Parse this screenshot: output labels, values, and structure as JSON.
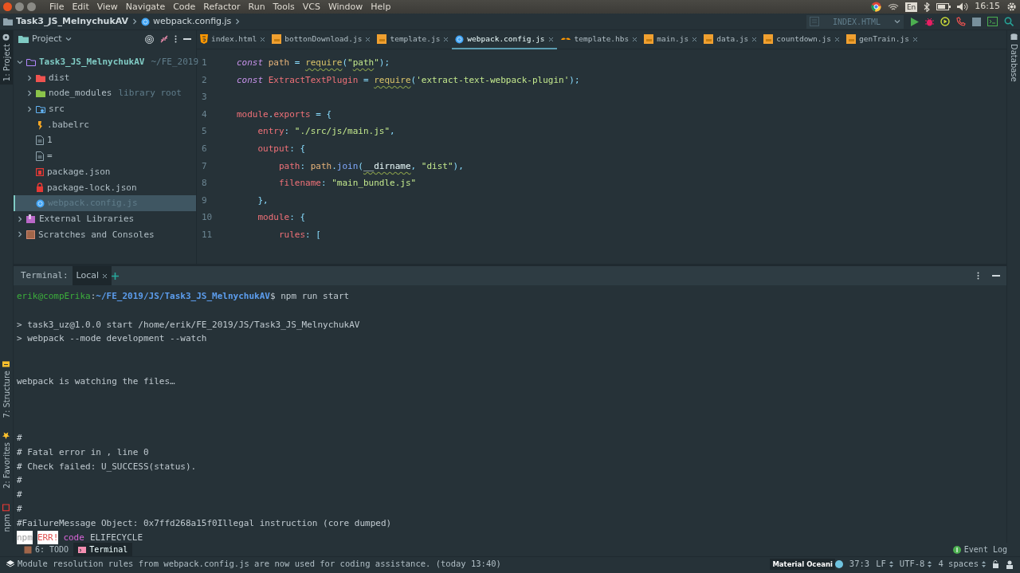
{
  "menu": [
    "File",
    "Edit",
    "View",
    "Navigate",
    "Code",
    "Refactor",
    "Run",
    "Tools",
    "VCS",
    "Window",
    "Help"
  ],
  "tray": {
    "keyboard_layout": "En",
    "time": "16:15"
  },
  "breadcrumb": [
    {
      "label": "Task3_JS_MelnychukAV",
      "kind": "folder"
    },
    {
      "label": "webpack.config.js",
      "kind": "webpack"
    }
  ],
  "run_config": {
    "label": "INDEX.HTML"
  },
  "top_tools": [
    {
      "label": "1: Project",
      "selected": true
    }
  ],
  "bottom_tools": [
    {
      "label": "7: Structure",
      "kind": "structure"
    },
    {
      "label": "2: Favorites",
      "kind": "favorites"
    },
    {
      "label": "npm",
      "kind": "npm"
    }
  ],
  "right_tools": [
    {
      "label": "Database"
    }
  ],
  "project": {
    "title": "Project",
    "tree": [
      {
        "label": "Task3_JS_MelnychukAV",
        "hint": "~/FE_2019",
        "kind": "folder-root",
        "expanded": true,
        "selected": false,
        "children": [
          {
            "label": "dist",
            "kind": "folder-dist",
            "expanded": false,
            "selected": false
          },
          {
            "label": "node_modules",
            "hint": "library root",
            "kind": "folder-lib",
            "expanded": false,
            "selected": false
          },
          {
            "label": "src",
            "kind": "folder-src",
            "expanded": false,
            "selected": false
          },
          {
            "label": ".babelrc",
            "kind": "babel",
            "selected": false
          },
          {
            "label": "1",
            "kind": "text",
            "selected": false
          },
          {
            "label": "=",
            "kind": "text",
            "selected": false
          },
          {
            "label": "package.json",
            "kind": "npm",
            "selected": false
          },
          {
            "label": "package-lock.json",
            "kind": "lock",
            "selected": false
          },
          {
            "label": "webpack.config.js",
            "kind": "webpack",
            "selected": true
          }
        ]
      },
      {
        "label": "External Libraries",
        "kind": "libraries",
        "expanded": false,
        "selected": false
      },
      {
        "label": "Scratches and Consoles",
        "kind": "scratches",
        "expanded": false,
        "selected": false
      }
    ]
  },
  "editor": {
    "tabs": [
      {
        "label": "index.html",
        "kind": "html",
        "selected": false
      },
      {
        "label": "bottonDownload.js",
        "kind": "js",
        "selected": false
      },
      {
        "label": "template.js",
        "kind": "js",
        "selected": false
      },
      {
        "label": "webpack.config.js",
        "kind": "webpack",
        "selected": true
      },
      {
        "label": "template.hbs",
        "kind": "hbs",
        "selected": false
      },
      {
        "label": "main.js",
        "kind": "js",
        "selected": false
      },
      {
        "label": "data.js",
        "kind": "js",
        "selected": false
      },
      {
        "label": "countdown.js",
        "kind": "js",
        "selected": false
      },
      {
        "label": "genTrain.js",
        "kind": "js",
        "selected": false
      }
    ],
    "lines": [
      {
        "number": "1",
        "tokens": [
          {
            "text": "const ",
            "kind": "kw"
          },
          {
            "text": "path",
            "kind": "var"
          },
          {
            "text": " = ",
            "kind": "punct"
          },
          {
            "text": "require",
            "kind": "func",
            "squiggle": true
          },
          {
            "text": "(",
            "kind": "punct"
          },
          {
            "text": "\"",
            "kind": "str"
          },
          {
            "text": "path",
            "kind": "str",
            "squiggle": true
          },
          {
            "text": "\"",
            "kind": "str"
          },
          {
            "text": ");",
            "kind": "punct"
          }
        ]
      },
      {
        "number": "2",
        "tokens": [
          {
            "text": "const ",
            "kind": "kw"
          },
          {
            "text": "ExtractTextPlugin",
            "kind": "cls"
          },
          {
            "text": " = ",
            "kind": "punct"
          },
          {
            "text": "require",
            "kind": "func",
            "squiggle": true
          },
          {
            "text": "(",
            "kind": "punct"
          },
          {
            "text": "'extract-text-webpack-plugin'",
            "kind": "str"
          },
          {
            "text": ");",
            "kind": "punct"
          }
        ]
      },
      {
        "number": "3"
      },
      {
        "number": "4",
        "tokens": [
          {
            "text": "module",
            "kind": "prop"
          },
          {
            "text": ".",
            "kind": "punct"
          },
          {
            "text": "exports",
            "kind": "prop"
          },
          {
            "text": " = {",
            "kind": "punct"
          }
        ]
      },
      {
        "number": "5",
        "tokens": [
          {
            "text": "    entry",
            "kind": "prop"
          },
          {
            "text": ": ",
            "kind": "punct"
          },
          {
            "text": "\"./src/js/main.js\"",
            "kind": "str"
          },
          {
            "text": ",",
            "kind": "punct"
          }
        ]
      },
      {
        "number": "6",
        "tokens": [
          {
            "text": "    output",
            "kind": "prop"
          },
          {
            "text": ": {",
            "kind": "punct"
          }
        ]
      },
      {
        "number": "7",
        "tokens": [
          {
            "text": "        path",
            "kind": "prop"
          },
          {
            "text": ": ",
            "kind": "punct"
          },
          {
            "text": "path",
            "kind": "var"
          },
          {
            "text": ".",
            "kind": "punct"
          },
          {
            "text": "join",
            "kind": "method"
          },
          {
            "text": "(",
            "kind": "punct"
          },
          {
            "text": "__dirname",
            "kind": "plain",
            "squiggle": true
          },
          {
            "text": ", ",
            "kind": "punct"
          },
          {
            "text": "\"dist\"",
            "kind": "str"
          },
          {
            "text": "),",
            "kind": "punct"
          }
        ]
      },
      {
        "number": "8",
        "tokens": [
          {
            "text": "        filename",
            "kind": "prop"
          },
          {
            "text": ": ",
            "kind": "punct"
          },
          {
            "text": "\"main_bundle.js\"",
            "kind": "str"
          }
        ]
      },
      {
        "number": "9",
        "tokens": [
          {
            "text": "    },",
            "kind": "punct"
          }
        ]
      },
      {
        "number": "10",
        "tokens": [
          {
            "text": "    module",
            "kind": "prop"
          },
          {
            "text": ": {",
            "kind": "punct"
          }
        ]
      },
      {
        "number": "11",
        "tokens": [
          {
            "text": "        rules",
            "kind": "prop"
          },
          {
            "text": ": [",
            "kind": "punct"
          }
        ]
      }
    ]
  },
  "terminal": {
    "title": "Terminal:",
    "tabs": [
      {
        "label": "Local",
        "selected": true
      }
    ],
    "lines": [
      {
        "kind": "text",
        "segments": [
          {
            "text": "erik@compErika",
            "kind": "user"
          },
          {
            "text": ":",
            "kind": "plain"
          },
          {
            "text": "~/FE_2019/JS/Task3_JS_MelnychukAV",
            "kind": "path"
          },
          {
            "text": "$ npm run start",
            "kind": "plain"
          }
        ]
      },
      {
        "kind": "blank"
      },
      {
        "kind": "text",
        "segments": [
          {
            "text": "> task3_uz@1.0.0 start /home/erik/FE_2019/JS/Task3_JS_MelnychukAV",
            "kind": "plain"
          }
        ]
      },
      {
        "kind": "text",
        "segments": [
          {
            "text": "> webpack --mode development --watch",
            "kind": "plain"
          }
        ]
      },
      {
        "kind": "blank"
      },
      {
        "kind": "blank"
      },
      {
        "kind": "text",
        "segments": [
          {
            "text": "webpack is watching the files…",
            "kind": "plain"
          }
        ]
      },
      {
        "kind": "blank"
      },
      {
        "kind": "blank"
      },
      {
        "kind": "blank"
      },
      {
        "kind": "text",
        "segments": [
          {
            "text": "#",
            "kind": "plain"
          }
        ]
      },
      {
        "kind": "text",
        "segments": [
          {
            "text": "# Fatal error in , line 0",
            "kind": "plain"
          }
        ]
      },
      {
        "kind": "text",
        "segments": [
          {
            "text": "# Check failed: U_SUCCESS(status).",
            "kind": "plain"
          }
        ]
      },
      {
        "kind": "text",
        "segments": [
          {
            "text": "#",
            "kind": "plain"
          }
        ]
      },
      {
        "kind": "text",
        "segments": [
          {
            "text": "#",
            "kind": "plain"
          }
        ]
      },
      {
        "kind": "text",
        "segments": [
          {
            "text": "#",
            "kind": "plain"
          }
        ]
      },
      {
        "kind": "text",
        "segments": [
          {
            "text": "#FailureMessage Object: 0x7ffd268a15f0Illegal instruction (core dumped)",
            "kind": "plain"
          }
        ]
      },
      {
        "kind": "text",
        "segments": [
          {
            "text": "npm",
            "kind": "badge"
          },
          {
            "text": "ERR!",
            "kind": "badge-error"
          },
          {
            "text": "code",
            "kind": "keyword"
          },
          {
            "text": "ELIFECYCLE",
            "kind": "plain"
          }
        ]
      }
    ]
  },
  "tool_tabs": [
    {
      "label": "6: TODO",
      "kind": "todo",
      "selected": false
    },
    {
      "label": "Terminal",
      "kind": "terminal",
      "selected": true
    }
  ],
  "event_log": "Event Log",
  "status": {
    "message": "Module resolution rules from webpack.config.js are now used for coding assistance. (today 13:40)",
    "theme": "Material Oceani",
    "position": "37:3",
    "line_ending": "LF",
    "encoding": "UTF-8",
    "indent": "4 spaces"
  }
}
